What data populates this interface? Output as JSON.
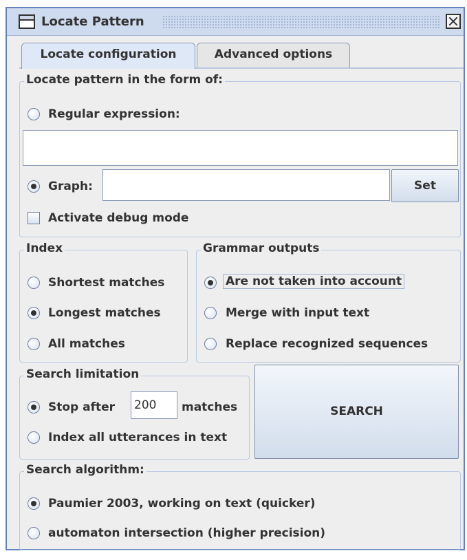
{
  "window": {
    "title": "Locate Pattern",
    "close_icon": "close-icon"
  },
  "tabs": [
    {
      "label": "Locate configuration",
      "active": true
    },
    {
      "label": "Advanced options",
      "active": false
    }
  ],
  "locate_pattern": {
    "legend": "Locate pattern in the form of:",
    "regex_label": "Regular expression:",
    "regex_value": "",
    "graph_label": "Graph:",
    "graph_value": "",
    "set_button": "Set",
    "debug_label": "Activate debug mode",
    "selected": "graph",
    "debug_checked": false
  },
  "index": {
    "legend": "Index",
    "options": [
      "Shortest matches",
      "Longest matches",
      "All matches"
    ],
    "selected": "Longest matches"
  },
  "grammar_outputs": {
    "legend": "Grammar outputs",
    "options": [
      "Are not taken into account",
      "Merge with input text",
      "Replace recognized sequences"
    ],
    "selected": "Are not taken into account"
  },
  "search_limitation": {
    "legend": "Search limitation",
    "stop_after_label": "Stop after",
    "stop_after_value": "200",
    "matches_label": "matches",
    "index_all_label": "Index all utterances in text",
    "selected": "Stop after"
  },
  "search_button": "SEARCH",
  "search_algorithm": {
    "legend": "Search algorithm:",
    "options": [
      "Paumier 2003, working on text (quicker)",
      "automaton intersection (higher precision)"
    ],
    "selected": "Paumier 2003, working on text (quicker)"
  }
}
